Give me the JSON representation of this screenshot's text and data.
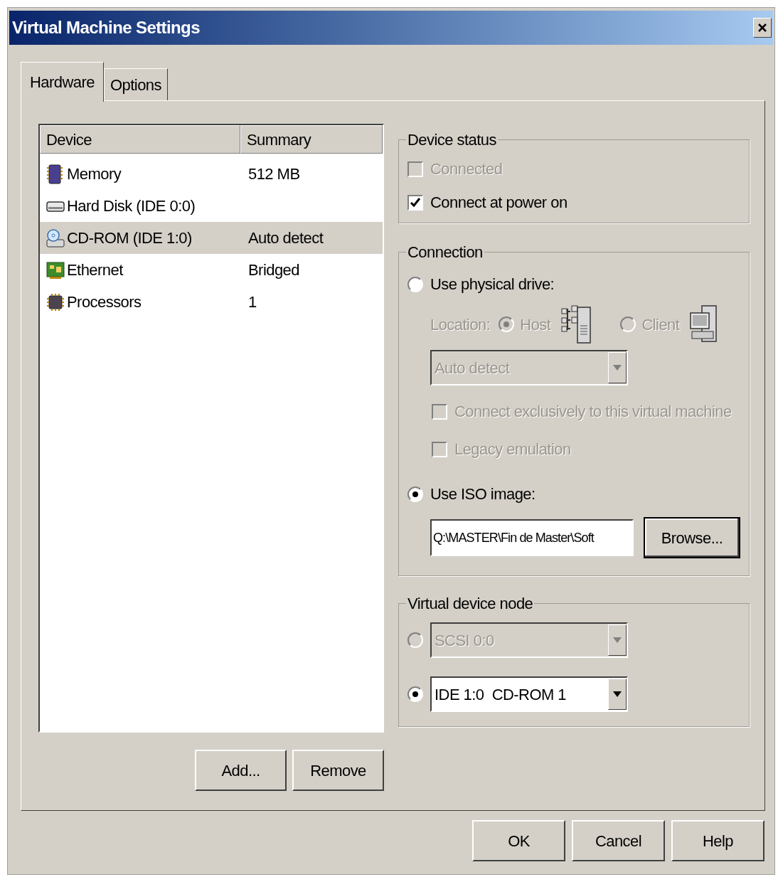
{
  "window": {
    "title": "Virtual Machine Settings"
  },
  "tabs": [
    {
      "label": "Hardware",
      "selected": true
    },
    {
      "label": "Options",
      "selected": false
    }
  ],
  "device_list": {
    "columns": [
      "Device",
      "Summary"
    ],
    "rows": [
      {
        "kind": "memory",
        "device": "Memory",
        "summary": "512 MB",
        "selected": false
      },
      {
        "kind": "disk",
        "device": "Hard Disk (IDE 0:0)",
        "selected": false
      },
      {
        "kind": "cdrom",
        "device": "CD-ROM (IDE 1:0)",
        "summary": "Auto detect",
        "selected": true
      },
      {
        "kind": "ethernet",
        "device": "Ethernet",
        "summary": "Bridged",
        "selected": false
      },
      {
        "kind": "processor",
        "device": "Processors",
        "summary": "1",
        "selected": false
      }
    ]
  },
  "list_buttons": [
    "Add...",
    "Remove"
  ],
  "device_status": {
    "title": "Device status",
    "options": [
      {
        "label": "Connected",
        "checked": false,
        "disabled": true
      },
      {
        "label": "Connect at power on",
        "checked": true,
        "disabled": false
      }
    ]
  },
  "connection": {
    "title": "Connection",
    "physical": {
      "label": "Use physical drive:",
      "selected": false
    },
    "location": {
      "label": "Location:",
      "options": [
        {
          "kind": "host",
          "label": "Host",
          "selected": true
        },
        {
          "kind": "client",
          "label": "Client",
          "selected": false
        }
      ]
    },
    "drive": {
      "value": "Auto detect"
    },
    "drive_options": [
      {
        "label": "Connect exclusively to this virtual machine",
        "checked": false
      },
      {
        "label": "Legacy emulation",
        "checked": false
      }
    ],
    "iso": {
      "label": "Use ISO image:",
      "selected": true,
      "path": "Q:\\MASTER\\Fin de Master\\Soft",
      "browse": "Browse..."
    }
  },
  "virtual_device_node": {
    "title": "Virtual device node",
    "options": [
      {
        "value": "SCSI 0:0",
        "selected": false,
        "disabled": true
      },
      {
        "value": "IDE 1:0  CD-ROM 1",
        "selected": true,
        "disabled": false
      }
    ]
  },
  "dialog_buttons": [
    "OK",
    "Cancel",
    "Help"
  ]
}
